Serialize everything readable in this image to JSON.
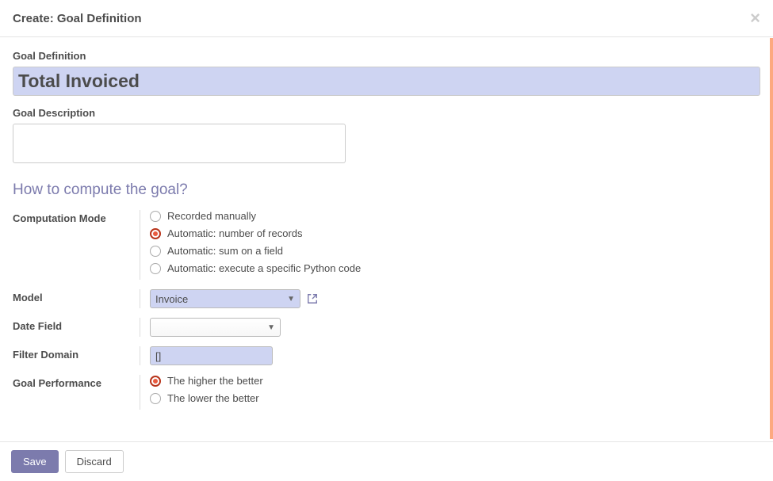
{
  "header": {
    "title": "Create: Goal Definition"
  },
  "form": {
    "goal_definition_label": "Goal Definition",
    "goal_definition_value": "Total Invoiced",
    "goal_description_label": "Goal Description",
    "goal_description_value": "",
    "compute_section_title": "How to compute the goal?",
    "computation_mode_label": "Computation Mode",
    "computation_options": {
      "recorded_manually": "Recorded manually",
      "auto_records": "Automatic: number of records",
      "auto_sum": "Automatic: sum on a field",
      "auto_python": "Automatic: execute a specific Python code"
    },
    "model_label": "Model",
    "model_value": "Invoice",
    "date_field_label": "Date Field",
    "date_field_value": "",
    "filter_domain_label": "Filter Domain",
    "filter_domain_value": "[]",
    "goal_performance_label": "Goal Performance",
    "performance_options": {
      "higher": "The higher the better",
      "lower": "The lower the better"
    }
  },
  "footer": {
    "save_label": "Save",
    "discard_label": "Discard"
  }
}
